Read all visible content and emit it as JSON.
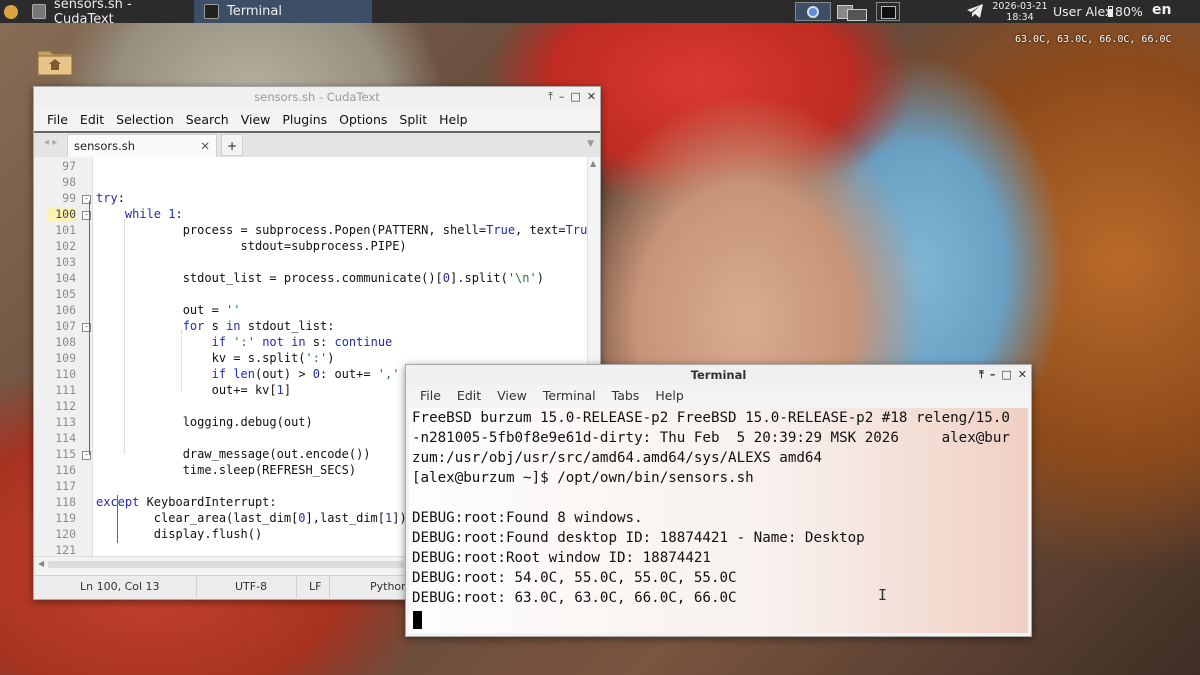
{
  "taskbar": {
    "apps": [
      {
        "label": "sensors.sh - CudaText"
      },
      {
        "label": "Terminal"
      }
    ],
    "clock_date": "2026-03-21",
    "clock_time": "18:34",
    "user": "User Alex",
    "battery": "80%",
    "lang": "en"
  },
  "temp_overlay": "63.0C, 63.0C, 66.0C, 66.0C",
  "cudatext": {
    "title": "sensors.sh - CudaText",
    "menu": [
      "File",
      "Edit",
      "Selection",
      "Search",
      "View",
      "Plugins",
      "Options",
      "Split",
      "Help"
    ],
    "tab": "sensors.sh",
    "tab_add": "+",
    "line_numbers": [
      "97",
      "98",
      "99",
      "100",
      "101",
      "102",
      "103",
      "104",
      "105",
      "106",
      "107",
      "108",
      "109",
      "110",
      "111",
      "112",
      "113",
      "114",
      "115",
      "116",
      "117",
      "118",
      "119",
      "120",
      "121"
    ],
    "current_line": "100",
    "status": {
      "position": "Ln 100, Col 13",
      "encoding": "UTF-8",
      "line_ending": "LF",
      "lexer": "Python"
    }
  },
  "terminal": {
    "title": "Terminal",
    "menu": [
      "File",
      "Edit",
      "View",
      "Terminal",
      "Tabs",
      "Help"
    ],
    "lines": [
      "FreeBSD burzum 15.0-RELEASE-p2 FreeBSD 15.0-RELEASE-p2 #18 releng/15.0",
      "-n281005-5fb0f8e9e61d-dirty: Thu Feb  5 20:39:29 MSK 2026     alex@bur",
      "zum:/usr/obj/usr/src/amd64.amd64/sys/ALEXS amd64",
      "[alex@burzum ~]$ /opt/own/bin/sensors.sh",
      "",
      "DEBUG:root:Found 8 windows.",
      "DEBUG:root:Found desktop ID: 18874421 - Name: Desktop",
      "DEBUG:root:Root window ID: 18874421",
      "DEBUG:root: 54.0C, 55.0C, 55.0C, 55.0C",
      "DEBUG:root: 63.0C, 63.0C, 66.0C, 66.0C"
    ]
  },
  "icons": {
    "home": "home-folder-icon",
    "telegram": "telegram-icon",
    "battery": "battery-icon"
  }
}
